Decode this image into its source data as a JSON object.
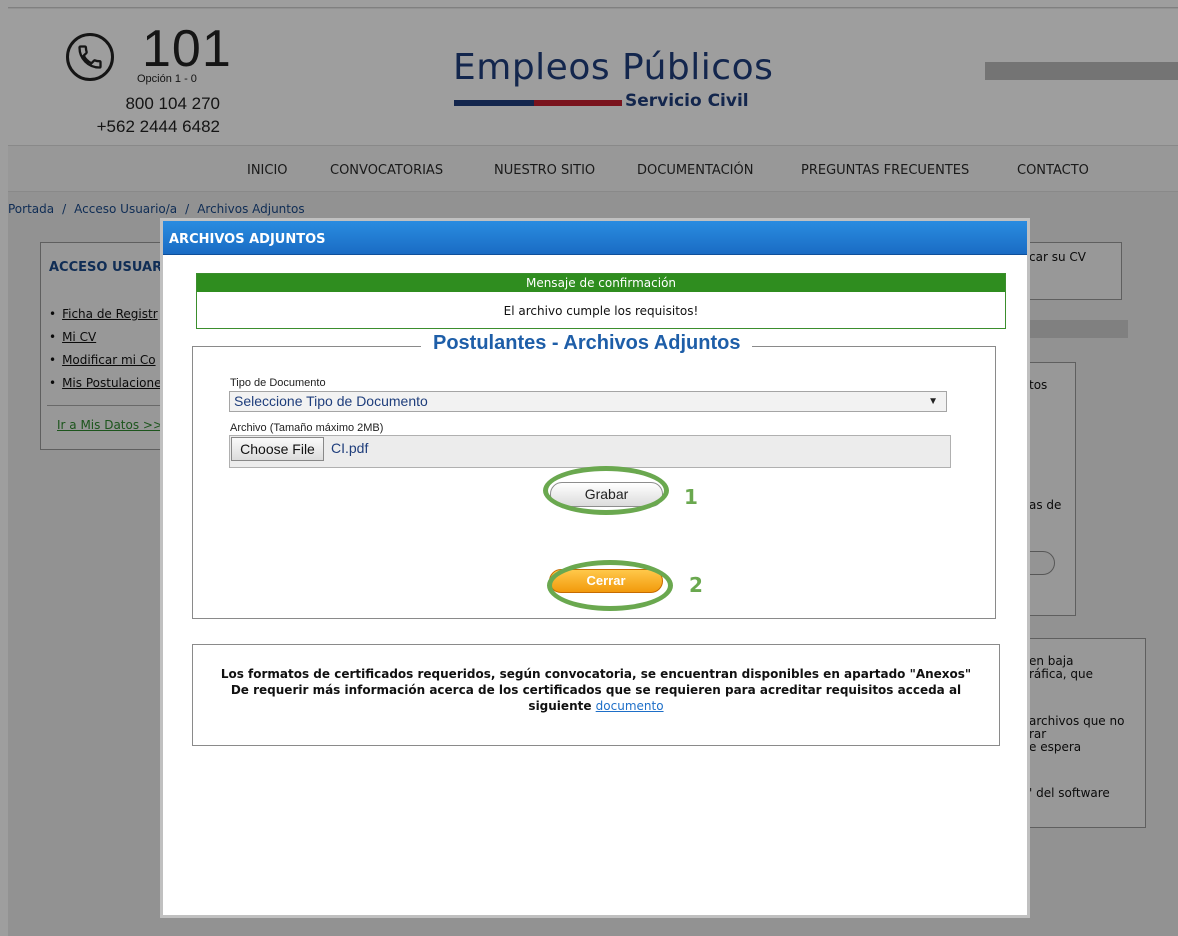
{
  "header": {
    "phone_main": "101",
    "phone_option": "Opción 1 - 0",
    "phone_line1": "800 104 270",
    "phone_line2": "+562 2444 6482",
    "logo_title": "Empleos Públicos",
    "logo_subtitle": "Servicio Civil"
  },
  "nav": {
    "items": [
      "INICIO",
      "CONVOCATORIAS",
      "NUESTRO SITIO",
      "DOCUMENTACIÓN",
      "PREGUNTAS FRECUENTES",
      "CONTACTO"
    ]
  },
  "breadcrumb": {
    "items": [
      "Portada",
      "Acceso Usuario/a",
      "Archivos Adjuntos"
    ],
    "separator": "/"
  },
  "left_panel": {
    "title": "ACCESO USUAR",
    "items": [
      "Ficha de Registr",
      "Mi CV",
      "Modificar mi Co",
      "Mis Postulacione"
    ],
    "link": "Ir a Mis Datos >>"
  },
  "right_panel": {
    "box1_text": "car su CV",
    "box2_lines": [
      "tos",
      "as de"
    ],
    "box3_lines": [
      "en baja",
      "ráfica, que",
      "archivos que no",
      "rar",
      "e espera",
      "' del software"
    ]
  },
  "modal": {
    "title": "ARCHIVOS ADJUNTOS",
    "confirm_header": "Mensaje de confirmación",
    "confirm_message": "El archivo cumple los requisitos!",
    "section_title": "Postulantes - Archivos Adjuntos",
    "doc_type_label": "Tipo de Documento",
    "doc_type_selected": "Seleccione Tipo de Documento",
    "file_label": "Archivo (Tamaño máximo 2MB)",
    "choose_file_label": "Choose File",
    "file_name": "CI.pdf",
    "save_label": "Grabar",
    "close_label": "Cerrar",
    "info_line1": "Los formatos de certificados requeridos, según convocatoria, se encuentran disponibles en apartado \"Anexos\"",
    "info_line2": "De requerir más información acerca de los certificados que se requieren para acreditar requisitos acceda al",
    "info_line3_prefix": "siguiente",
    "info_link": "documento"
  },
  "annotations": {
    "step1": "1",
    "step2": "2",
    "color": "#6aa84f"
  },
  "colors": {
    "modal_titlebar": "#1a6cc4",
    "confirm_header": "#2f8d1f",
    "section_title": "#1e5ea8",
    "close_button": "#f29a0c",
    "logo_blue": "#1f3e7c",
    "logo_red": "#c5202f"
  },
  "icons": {
    "phone": "phone-icon",
    "select_arrow": "chevron-down-icon"
  }
}
